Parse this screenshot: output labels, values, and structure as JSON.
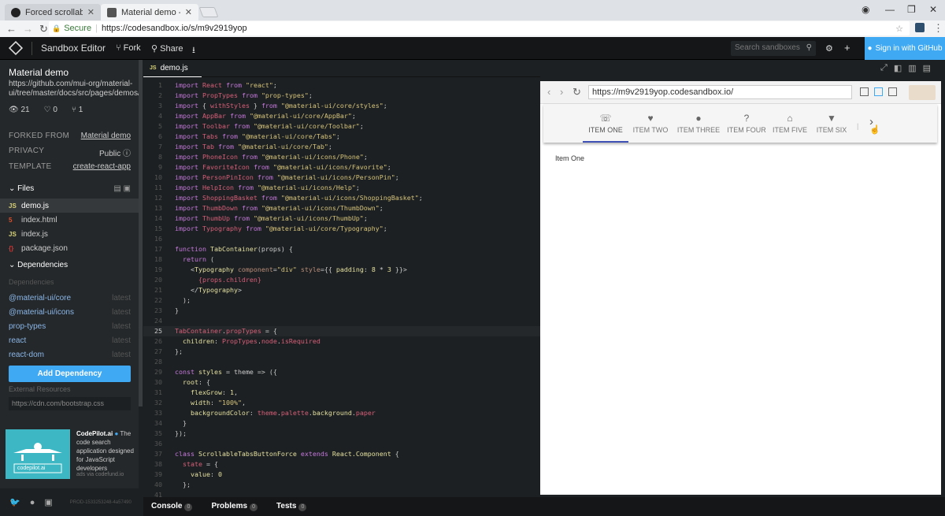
{
  "browser": {
    "tabs": [
      {
        "label": "Forced scrollable Tabs no"
      },
      {
        "label": "Material demo - CodeSa"
      }
    ],
    "secure_label": "Secure",
    "url": "https://codesandbox.io/s/m9v2919yop"
  },
  "header": {
    "title": "Sandbox Editor",
    "fork_label": "Fork",
    "share_label": "Share",
    "search_placeholder": "Search sandboxes",
    "signin_label": "Sign in with GitHub"
  },
  "sidebar": {
    "title": "Material demo",
    "description": "https://github.com/mui-org/material-ui/tree/master/docs/src/pages/demos/tabs",
    "stats": {
      "views": "21",
      "likes": "0",
      "forks": "1"
    },
    "forked_from_label": "FORKED FROM",
    "forked_from_value": "Material demo",
    "privacy_label": "PRIVACY",
    "privacy_value": "Public",
    "template_label": "TEMPLATE",
    "template_value": "create-react-app",
    "files_label": "Files",
    "files": [
      {
        "name": "demo.js",
        "icon": "JS"
      },
      {
        "name": "index.html",
        "icon": "5"
      },
      {
        "name": "index.js",
        "icon": "JS"
      },
      {
        "name": "package.json",
        "icon": "{}"
      }
    ],
    "dependencies_label": "Dependencies",
    "dependencies_sub": "Dependencies",
    "dependencies": [
      {
        "name": "@material-ui/core",
        "version": "latest"
      },
      {
        "name": "@material-ui/icons",
        "version": "latest"
      },
      {
        "name": "prop-types",
        "version": "latest"
      },
      {
        "name": "react",
        "version": "latest"
      },
      {
        "name": "react-dom",
        "version": "latest"
      }
    ],
    "add_dependency_label": "Add Dependency",
    "external_resources_label": "External Resources",
    "cdn_placeholder": "https://cdn.com/bootstrap.css",
    "ad": {
      "brand": "CodePilot.ai",
      "text": "The code search application designed for JavaScript developers",
      "via": "ads via codefund.io",
      "img_label": "codepilot.ai"
    },
    "prod_id": "PROD-1533253248-4a57490"
  },
  "editor": {
    "tab_label": "demo.js",
    "tab_icon": "JS",
    "current_line": 25
  },
  "preview": {
    "url": "https://m9v2919yop.codesandbox.io/",
    "tabs": [
      {
        "label": "Item One",
        "icon": "☏"
      },
      {
        "label": "Item Two",
        "icon": "♥"
      },
      {
        "label": "Item Three",
        "icon": "●"
      },
      {
        "label": "Item Four",
        "icon": "?"
      },
      {
        "label": "Item Five",
        "icon": "⌂"
      },
      {
        "label": "Item Six",
        "icon": "▼"
      }
    ],
    "content": "Item One"
  },
  "bottom": {
    "console_label": "Console",
    "console_count": "0",
    "problems_label": "Problems",
    "problems_count": "0",
    "tests_label": "Tests",
    "tests_count": "0"
  }
}
